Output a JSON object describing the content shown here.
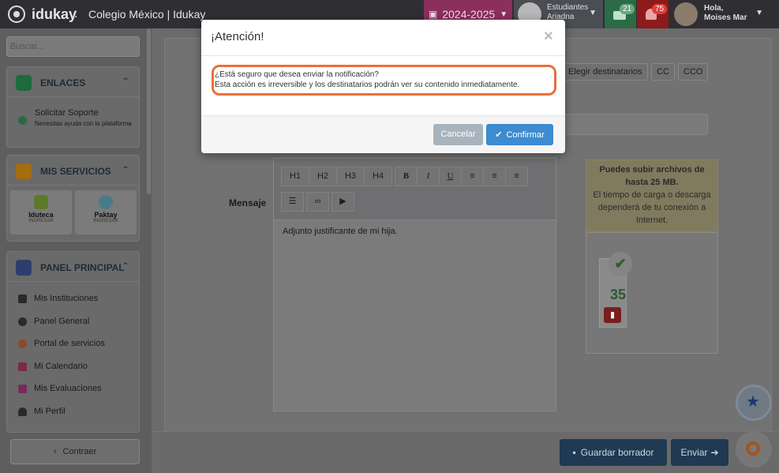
{
  "topbar": {
    "brand": "idukay",
    "separator": ":",
    "school": "Colegio México | Idukay",
    "year": "2024-2025",
    "role_line1": "Estudiantes",
    "role_line2": "Ariadna",
    "messages_count": "21",
    "notifications_count": "75",
    "greeting": "Hola,",
    "user_name": "Moises Mar"
  },
  "sidebar": {
    "search_placeholder": "Buscar...",
    "links_title": "ENLACES",
    "support_title": "Solicitar Soporte",
    "support_sub": "Necesitas ayuda con la plataforma",
    "services_title": "MIS SERVICIOS",
    "services": [
      {
        "name": "Iduteca",
        "action": "INGRESAR"
      },
      {
        "name": "Paktay",
        "action": "INGRESAR"
      }
    ],
    "panel_title": "PANEL PRINCIPAL",
    "nav": [
      "Mis Instituciones",
      "Panel General",
      "Portal de servicios",
      "Mi Calendario",
      "Mis Evaluaciones",
      "Mi Perfil"
    ],
    "collapse_label": "Contraer"
  },
  "compose": {
    "recipients_label": "Elegir destinatarios",
    "cc_label": "CC",
    "cco_label": "CCO",
    "message_label": "Mensaje",
    "toolbar": [
      "H1",
      "H2",
      "H3",
      "H4",
      "B",
      "I",
      "U"
    ],
    "body_text": "Adjunto justificante de mi hija.",
    "upload_note_bold": "Puedes subir archivos de hasta 25 MB.",
    "upload_note": "El tiempo de carga o descarga dependerá de tu conexión a Internet.",
    "file_size": "35",
    "save_draft_label": "Guardar borrador",
    "send_label": "Enviar"
  },
  "modal": {
    "title": "¡Atención!",
    "close_glyph": "×",
    "line1": "¿Está seguro que desea enviar la notificación?",
    "line2": "Esta acción es irreversible y los destinatarios podrán ver su contenido inmediatamente.",
    "cancel_label": "Cancelar",
    "confirm_label": "Confirmar"
  }
}
